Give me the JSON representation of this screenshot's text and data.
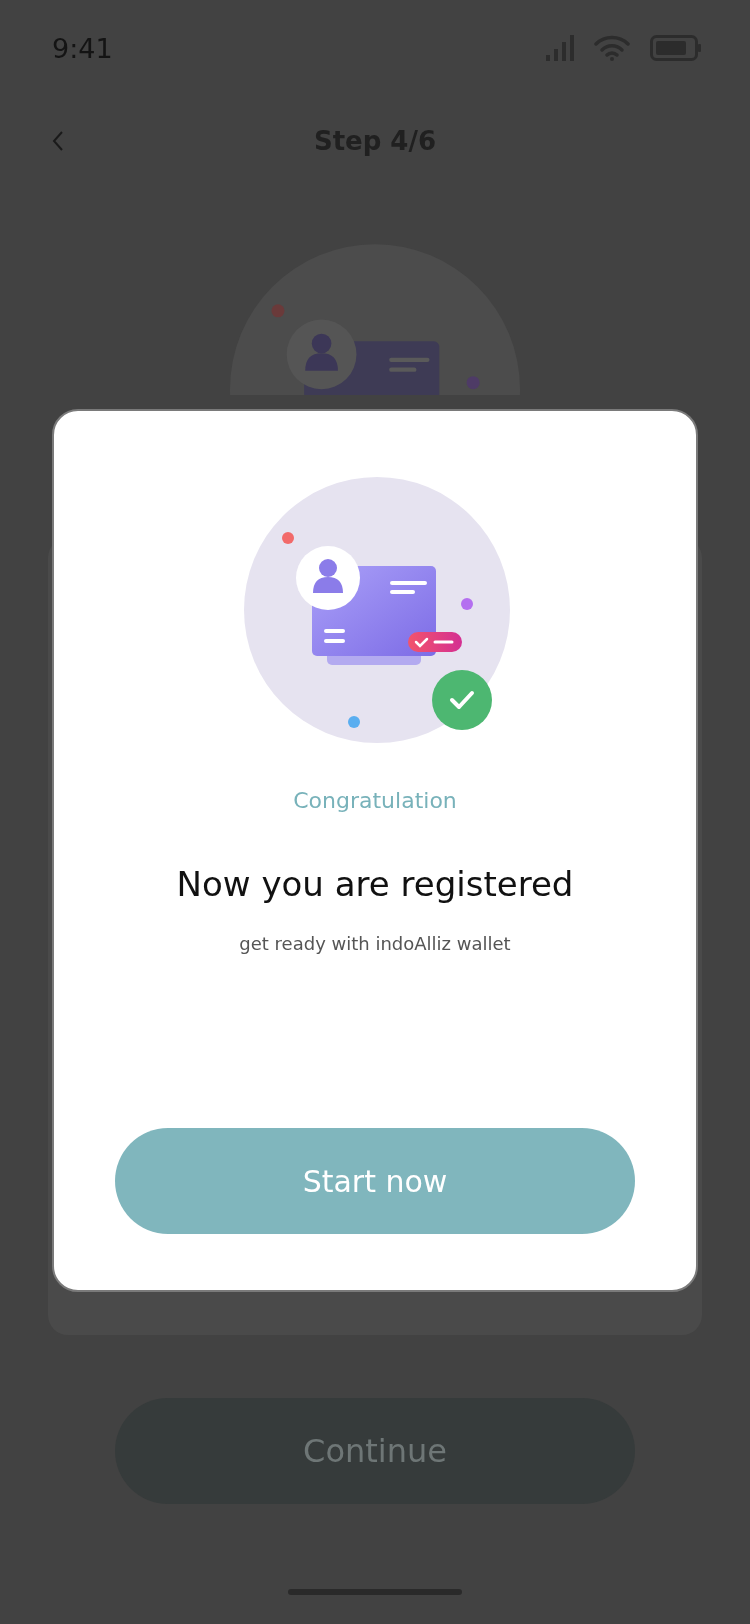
{
  "status_bar": {
    "time": "9:41"
  },
  "nav": {
    "title": "Step 4/6"
  },
  "background_button": {
    "label": "Continue"
  },
  "dialog": {
    "overline": "Congratulation",
    "title": "Now you are registered",
    "subtitle": "get ready with indoAlliz wallet",
    "button": {
      "label": "Start now"
    }
  }
}
